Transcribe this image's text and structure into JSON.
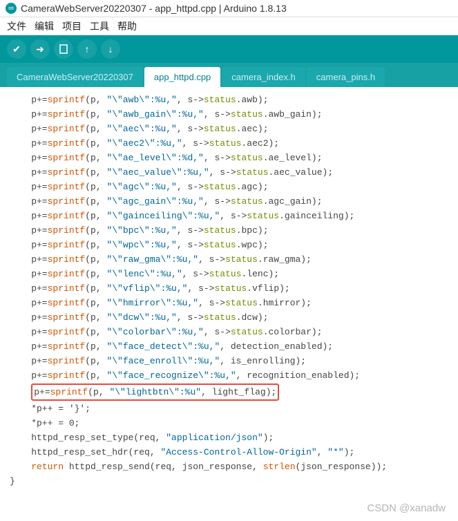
{
  "window": {
    "title": "CameraWebServer20220307 - app_httpd.cpp | Arduino 1.8.13"
  },
  "menu": {
    "file": "文件",
    "edit": "编辑",
    "project": "项目",
    "tools": "工具",
    "help": "帮助"
  },
  "tabs": [
    {
      "label": "CameraWebServer20220307",
      "active": false
    },
    {
      "label": "app_httpd.cpp",
      "active": true
    },
    {
      "label": "camera_index.h",
      "active": false
    },
    {
      "label": "camera_pins.h",
      "active": false
    }
  ],
  "code": {
    "lines": [
      {
        "field": "awb",
        "var": "s->status.awb",
        "fmt": "%u,"
      },
      {
        "field": "awb_gain",
        "var": "s->status.awb_gain",
        "fmt": "%u,"
      },
      {
        "field": "aec",
        "var": "s->status.aec",
        "fmt": "%u,"
      },
      {
        "field": "aec2",
        "var": "s->status.aec2",
        "fmt": "%u,"
      },
      {
        "field": "ae_level",
        "var": "s->status.ae_level",
        "fmt": "%d,"
      },
      {
        "field": "aec_value",
        "var": "s->status.aec_value",
        "fmt": "%u,"
      },
      {
        "field": "agc",
        "var": "s->status.agc",
        "fmt": "%u,"
      },
      {
        "field": "agc_gain",
        "var": "s->status.agc_gain",
        "fmt": "%u,"
      },
      {
        "field": "gainceiling",
        "var": "s->status.gainceiling",
        "fmt": "%u,"
      },
      {
        "field": "bpc",
        "var": "s->status.bpc",
        "fmt": "%u,"
      },
      {
        "field": "wpc",
        "var": "s->status.wpc",
        "fmt": "%u,"
      },
      {
        "field": "raw_gma",
        "var": "s->status.raw_gma",
        "fmt": "%u,"
      },
      {
        "field": "lenc",
        "var": "s->status.lenc",
        "fmt": "%u,"
      },
      {
        "field": "vflip",
        "var": "s->status.vflip",
        "fmt": "%u,"
      },
      {
        "field": "hmirror",
        "var": "s->status.hmirror",
        "fmt": "%u,"
      },
      {
        "field": "dcw",
        "var": "s->status.dcw",
        "fmt": "%u,"
      },
      {
        "field": "colorbar",
        "var": "s->status.colorbar",
        "fmt": "%u,"
      },
      {
        "field": "face_detect",
        "var": "detection_enabled",
        "fmt": "%u,"
      },
      {
        "field": "face_enroll",
        "var": "is_enrolling",
        "fmt": "%u,"
      },
      {
        "field": "face_recognize",
        "var": "recognition_enabled",
        "fmt": "%u,"
      },
      {
        "field": "lightbtn",
        "var": "light_flag",
        "fmt": "%u",
        "highlight": true
      }
    ],
    "tail": {
      "brace": "*p++ = '}';",
      "zero": "*p++ = 0;",
      "settype": "httpd_resp_set_type(req, \"application/json\");",
      "sethdr": "httpd_resp_set_hdr(req, \"Access-Control-Allow-Origin\", \"*\");",
      "ret": "return httpd_resp_send(req, json_response, strlen(json_response));"
    }
  },
  "watermark": "CSDN @xanadw"
}
